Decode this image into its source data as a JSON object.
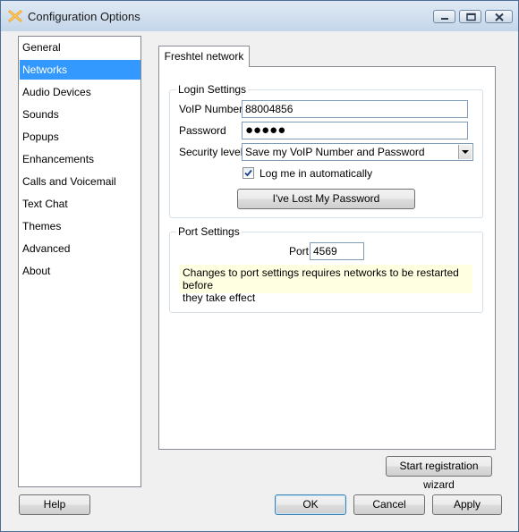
{
  "window": {
    "title": "Configuration Options"
  },
  "sidebar": {
    "items": [
      {
        "label": "General"
      },
      {
        "label": "Networks",
        "selected": true
      },
      {
        "label": "Audio Devices"
      },
      {
        "label": "Sounds"
      },
      {
        "label": "Popups"
      },
      {
        "label": "Enhancements"
      },
      {
        "label": "Calls and Voicemail"
      },
      {
        "label": "Text Chat"
      },
      {
        "label": "Themes"
      },
      {
        "label": "Advanced"
      },
      {
        "label": "About"
      }
    ]
  },
  "tab": {
    "label": "Freshtel network"
  },
  "login": {
    "legend": "Login Settings",
    "voip_label": "VoIP Number",
    "voip_value": "88004856",
    "password_label": "Password",
    "password_mask": "●●●●●",
    "security_label": "Security level",
    "security_value": "Save my VoIP Number and Password",
    "auto_login_label": "Log me in automatically",
    "auto_login_checked": true,
    "lost_password_button": "I've Lost My Password"
  },
  "port": {
    "legend": "Port Settings",
    "port_label": "Port",
    "port_value": "4569",
    "note_line1": "Changes to port settings requires networks to be restarted before",
    "note_line2": "they take effect"
  },
  "buttons": {
    "wizard": "Start registration wizard",
    "help": "Help",
    "ok": "OK",
    "cancel": "Cancel",
    "apply": "Apply"
  },
  "colors": {
    "selection": "#3399ff",
    "note_background": "#ffffe1",
    "app_icon": "#f5a623"
  }
}
